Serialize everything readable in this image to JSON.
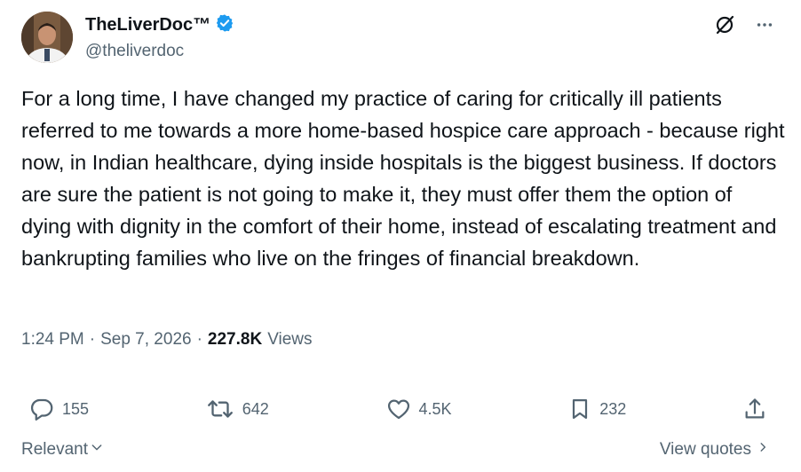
{
  "author": {
    "name": "TheLiverDoc™",
    "handle": "@theliverdoc",
    "verified_color": "#1d9bf0"
  },
  "tweet": {
    "text": "For a long time, I have changed my practice of caring for critically ill patients referred to me towards a more home-based hospice care approach - because right now, in Indian healthcare, dying inside hospitals is the biggest business. If doctors are sure the patient is not going to make it, they must offer them the option of dying with dignity in the comfort of their home, instead of escalating treatment and bankrupting families who live on the fringes of financial breakdown.",
    "time": "1:24 PM",
    "separator": "·",
    "date": "Sep 7, 2026",
    "views_count": "227.8K",
    "views_label": "Views"
  },
  "actions": {
    "replies": "155",
    "reposts": "642",
    "likes": "4.5K",
    "bookmarks": "232"
  },
  "footer": {
    "sort_label": "Relevant",
    "quotes_label": "View quotes"
  },
  "icons": {
    "top": [
      "grok-slash-icon",
      "more-icon"
    ],
    "actions": [
      "reply-icon",
      "repost-icon",
      "like-icon",
      "bookmark-icon",
      "share-icon"
    ]
  },
  "colors": {
    "text": "#0f1419",
    "secondary": "#536471",
    "accent": "#1d9bf0"
  }
}
